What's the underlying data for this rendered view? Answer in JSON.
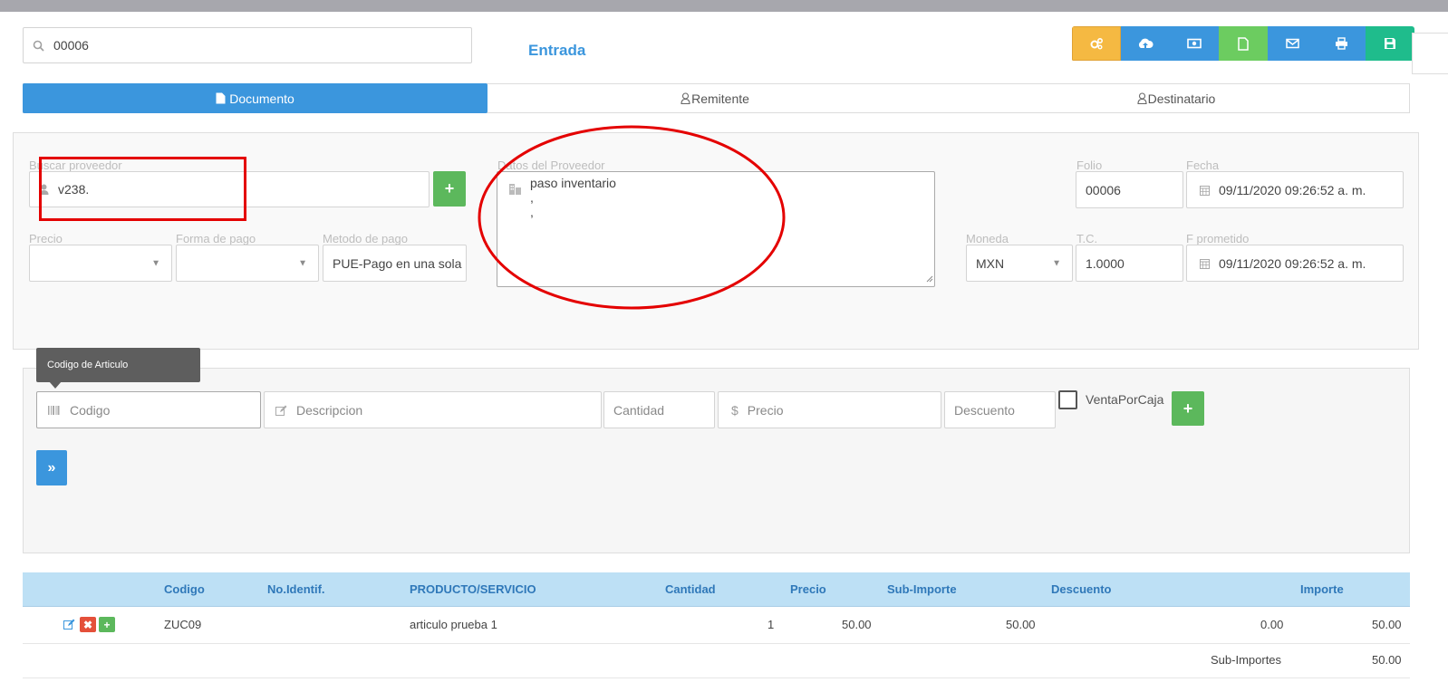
{
  "search": {
    "value": "00006"
  },
  "page_title": "Entrada",
  "toolbar": {
    "buttons": [
      {
        "name": "settings",
        "icon": "cogs-icon",
        "color": "#f5b942"
      },
      {
        "name": "cloud",
        "icon": "cloud-upload-icon",
        "color": "#3b96dd"
      },
      {
        "name": "money",
        "icon": "money-icon",
        "color": "#3b96dd"
      },
      {
        "name": "document",
        "icon": "file-icon",
        "color": "#6ccc60"
      },
      {
        "name": "mail",
        "icon": "envelope-icon",
        "color": "#3b96dd"
      },
      {
        "name": "print",
        "icon": "print-icon",
        "color": "#3b96dd"
      },
      {
        "name": "save",
        "icon": "save-icon",
        "color": "#1fbc8c"
      }
    ]
  },
  "tabs": [
    {
      "label": "Documento",
      "active": true
    },
    {
      "label": "Remitente",
      "active": false
    },
    {
      "label": "Destinatario",
      "active": false
    }
  ],
  "form": {
    "proveedor_label": "Buscar proveedor",
    "proveedor_value": "v238.",
    "datos_label": "Datos del Proveedor",
    "datos_lines": [
      "paso inventario",
      ",",
      ","
    ],
    "folio_label": "Folio",
    "folio_value": "00006",
    "fecha_label": "Fecha",
    "fecha_value": "09/11/2020 09:26:52 a. m.",
    "precio_label": "Precio",
    "forma_label": "Forma de pago",
    "metodo_label": "Metodo de pago",
    "metodo_value": "PUE-Pago en una sola",
    "moneda_label": "Moneda",
    "moneda_value": "MXN",
    "tc_label": "T.C.",
    "tc_value": "1.0000",
    "fprom_label": "F prometido",
    "fprom_value": "09/11/2020 09:26:52 a. m."
  },
  "article": {
    "tooltip": "Codigo de Articulo",
    "codigo_placeholder": "Codigo",
    "descripcion_placeholder": "Descripcion",
    "cantidad_placeholder": "Cantidad",
    "precio_placeholder": "Precio",
    "descuento_placeholder": "Descuento",
    "ventaporcaja_label": "VentaPorCaja",
    "add_label": "+",
    "next_label": "»"
  },
  "table": {
    "headers": [
      "Codigo",
      "No.Identif.",
      "PRODUCTO/SERVICIO",
      "Cantidad",
      "Precio",
      "Sub-Importe",
      "Descuento",
      "Importe"
    ],
    "rows": [
      {
        "codigo": "ZUC09",
        "no_identif": "",
        "producto": "articulo prueba 1",
        "cantidad": "1",
        "precio": "50.00",
        "subimporte": "50.00",
        "descuento": "0.00",
        "importe": "50.00"
      }
    ],
    "footer_label": "Sub-Importes",
    "footer_value": "50.00"
  },
  "colors": {
    "primary": "#3b96dd",
    "success": "#5cb85c",
    "annotation": "#e40000"
  }
}
